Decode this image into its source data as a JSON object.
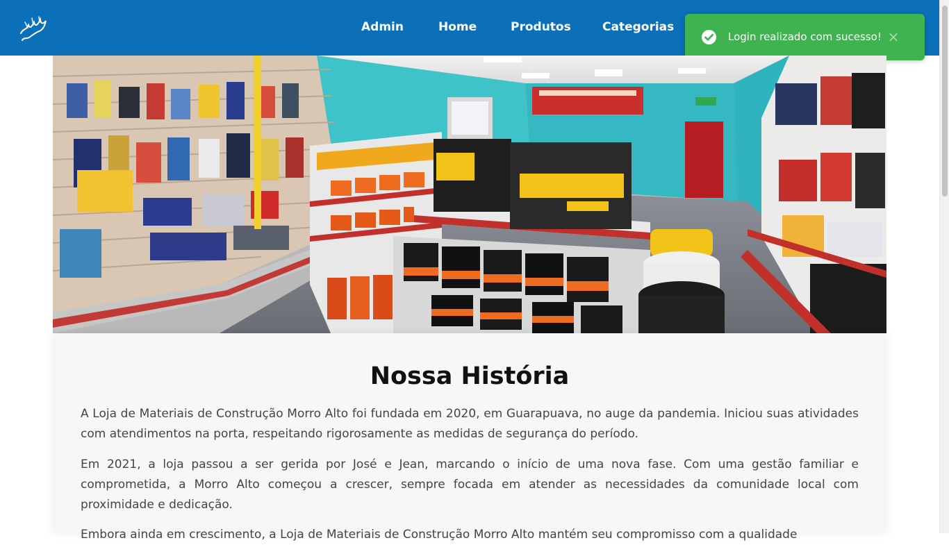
{
  "header": {
    "logo_icon": "brand-logo-icon",
    "nav": [
      {
        "label": "Admin"
      },
      {
        "label": "Home"
      },
      {
        "label": "Produtos"
      },
      {
        "label": "Categorias"
      }
    ]
  },
  "toast": {
    "message": "Login realizado com sucesso!",
    "icon": "check-circle-icon",
    "close_symbol": "×"
  },
  "hero": {
    "image_semantic": "hardware-store-interior-photo"
  },
  "about": {
    "title": "Nossa História",
    "paragraphs": [
      "A Loja de Materiais de Construção Morro Alto foi fundada em 2020, em Guarapuava, no auge da pandemia. Iniciou suas atividades com atendimentos na porta, respeitando rigorosamente as medidas de segurança do período.",
      "Em 2021, a loja passou a ser gerida por José e Jean, marcando o início de uma nova fase. Com uma gestão familiar e comprometida, a Morro Alto começou a crescer, sempre focada em atender as necessidades da comunidade local com proximidade e dedicação.",
      "Embora ainda em crescimento, a Loja de Materiais de Construção Morro Alto mantém seu compromisso com a qualidade"
    ]
  },
  "colors": {
    "navbar": "#0b70b8",
    "toast": "#3fb34f",
    "background": "#f7f7f7"
  }
}
